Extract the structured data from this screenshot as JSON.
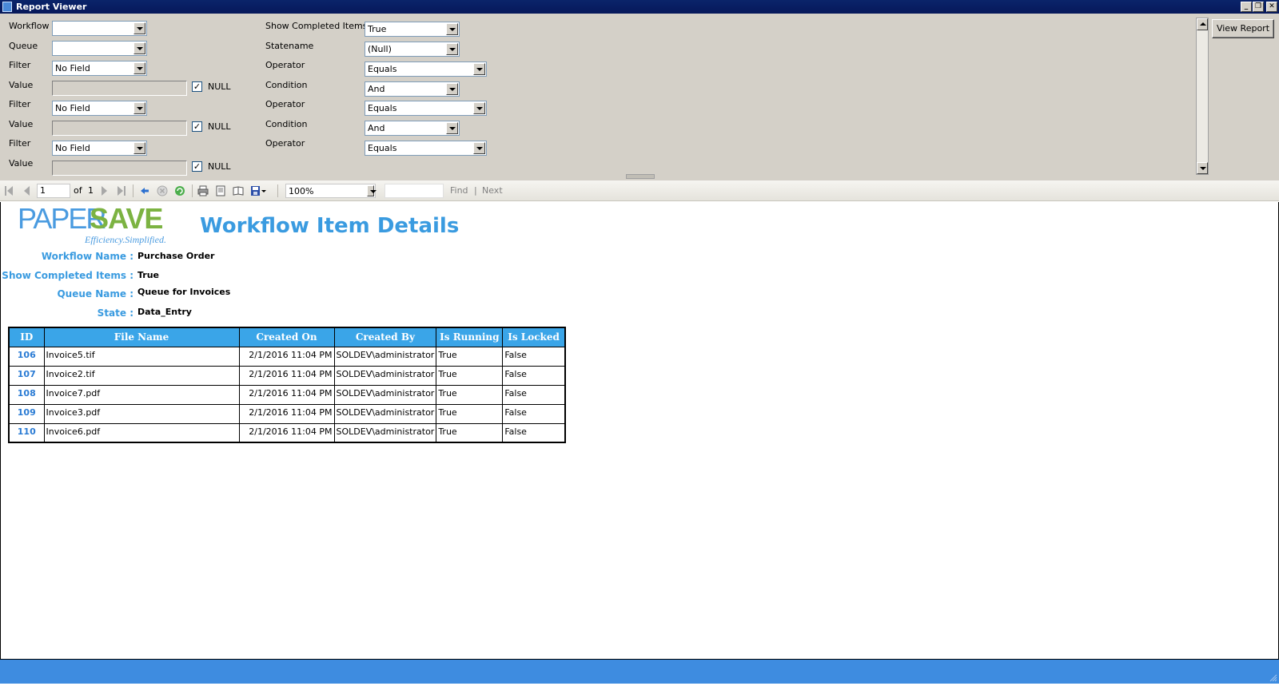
{
  "window": {
    "title": "Report Viewer"
  },
  "params": {
    "workflow_label": "Workflow",
    "queue_label": "Queue",
    "filter_label": "Filter",
    "value_label": "Value",
    "null_label": "NULL",
    "show_completed_label": "Show Completed Items",
    "statename_label": "Statename",
    "operator_label": "Operator",
    "condition_label": "Condition",
    "workflow_value": "",
    "queue_value": "",
    "filters": [
      {
        "field": "No Field",
        "operator": "Equals",
        "null_checked": true,
        "condition": "And"
      },
      {
        "field": "No Field",
        "operator": "Equals",
        "null_checked": true,
        "condition": "And"
      },
      {
        "field": "No Field",
        "operator": "Equals",
        "null_checked": true
      }
    ],
    "show_completed_value": "True",
    "statename_value": "(Null)",
    "view_report_label": "View Report"
  },
  "toolbar": {
    "page_current": "1",
    "of_label": "of",
    "page_total": "1",
    "zoom": "100%",
    "find_value": "",
    "find_label": "Find",
    "separator": "|",
    "next_label": "Next"
  },
  "report": {
    "logo_paper": "PAPER",
    "logo_save": "SAVE",
    "logo_tagline": "Efficiency.Simplified.",
    "title": "Workflow Item Details",
    "header": [
      {
        "label": "Workflow Name :",
        "value": "Purchase Order"
      },
      {
        "label": "Show Completed Items :",
        "value": "True"
      },
      {
        "label": "Queue Name :",
        "value": "Queue for Invoices"
      },
      {
        "label": "State :",
        "value": "Data_Entry"
      }
    ],
    "columns": [
      "ID",
      "File Name",
      "Created On",
      "Created By",
      "Is Running",
      "Is Locked"
    ],
    "rows": [
      {
        "id": "106",
        "file": "Invoice5.tif",
        "created_on": "2/1/2016 11:04 PM",
        "created_by": "SOLDEV\\administrator",
        "running": "True",
        "locked": "False"
      },
      {
        "id": "107",
        "file": "Invoice2.tif",
        "created_on": "2/1/2016 11:04 PM",
        "created_by": "SOLDEV\\administrator",
        "running": "True",
        "locked": "False"
      },
      {
        "id": "108",
        "file": "Invoice7.pdf",
        "created_on": "2/1/2016 11:04 PM",
        "created_by": "SOLDEV\\administrator",
        "running": "True",
        "locked": "False"
      },
      {
        "id": "109",
        "file": "Invoice3.pdf",
        "created_on": "2/1/2016 11:04 PM",
        "created_by": "SOLDEV\\administrator",
        "running": "True",
        "locked": "False"
      },
      {
        "id": "110",
        "file": "Invoice6.pdf",
        "created_on": "2/1/2016 11:04 PM",
        "created_by": "SOLDEV\\administrator",
        "running": "True",
        "locked": "False"
      }
    ]
  },
  "colors": {
    "titlebar": "#0a246a",
    "accent": "#3a9be0",
    "header_bg": "#3aa5e8",
    "logo_green": "#7cb342",
    "statusbar": "#3e8ce0"
  }
}
